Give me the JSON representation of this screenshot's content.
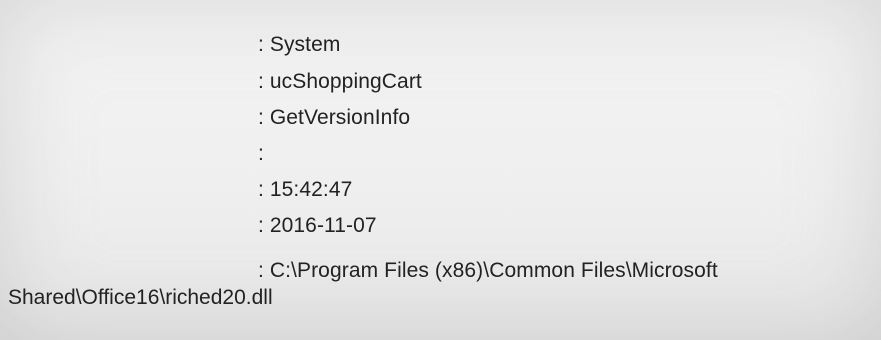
{
  "details": {
    "rows": [
      {
        "separator": ":",
        "value": "System"
      },
      {
        "separator": ":",
        "value": "ucShoppingCart"
      },
      {
        "separator": ":",
        "value": "GetVersionInfo"
      },
      {
        "separator": ":",
        "value": ""
      },
      {
        "separator": ":",
        "value": "15:42:47"
      },
      {
        "separator": ":",
        "value": "2016-11-07"
      },
      {
        "separator": ":",
        "value": "C:\\Program Files (x86)\\Common Files\\Microsoft"
      }
    ],
    "continuation": "Shared\\Office16\\riched20.dll"
  }
}
